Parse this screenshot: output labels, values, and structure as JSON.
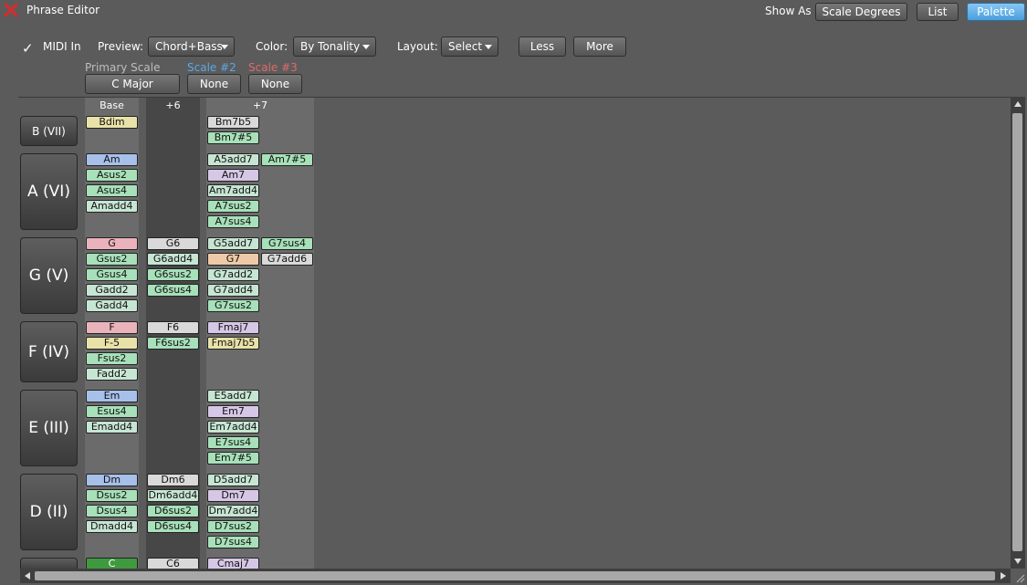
{
  "window": {
    "title": "Phrase Editor"
  },
  "show_as": {
    "label": "Show As",
    "buttons": [
      {
        "label": "Scale Degrees",
        "active": false
      },
      {
        "label": "List",
        "active": false
      },
      {
        "label": "Palette",
        "active": true
      }
    ]
  },
  "toolbar": {
    "midi_label": "MIDI In",
    "midi_checked": true,
    "check_glyph": "✓",
    "preview_label": "Preview:",
    "preview_value": "Chord+Bass",
    "color_label": "Color:",
    "color_value": "By Tonality",
    "layout_label": "Layout:",
    "layout_value": "Select",
    "less_label": "Less",
    "more_label": "More"
  },
  "scales": {
    "primary_label": "Primary Scale",
    "primary_value": "C Major",
    "scale2_label": "Scale #2",
    "scale2_value": "None",
    "scale3_label": "Scale #3",
    "scale3_value": "None"
  },
  "columns": [
    {
      "label": "Base"
    },
    {
      "label": "+6"
    },
    {
      "label": "+7"
    }
  ],
  "rows": [
    {
      "label": "B (VII)",
      "base": [
        {
          "name": "Bdim",
          "color": "#e8e2a8"
        }
      ],
      "six": [],
      "seven": [
        [
          {
            "name": "Bm7b5",
            "color": "#d9d9d9"
          }
        ],
        [
          {
            "name": "Bm7#5",
            "color": "#a7e0b9"
          }
        ]
      ]
    },
    {
      "label": "A (VI)",
      "base": [
        {
          "name": "Am",
          "color": "#a7c0ea"
        },
        {
          "name": "Asus2",
          "color": "#a7e0b9"
        },
        {
          "name": "Asus4",
          "color": "#a7e0b9"
        },
        {
          "name": "Amadd4",
          "color": "#c7e5d3"
        }
      ],
      "six": [],
      "seven": [
        [
          {
            "name": "A5add7",
            "color": "#c7e5d3"
          },
          {
            "name": "Am7#5",
            "color": "#a7e0b9"
          }
        ],
        [
          {
            "name": "Am7",
            "color": "#d6c7e6"
          }
        ],
        [
          {
            "name": "Am7add4",
            "color": "#c7e5d3"
          }
        ],
        [
          {
            "name": "A7sus2",
            "color": "#a7e0b9"
          }
        ],
        [
          {
            "name": "A7sus4",
            "color": "#a7e0b9"
          }
        ]
      ]
    },
    {
      "label": "G (V)",
      "base": [
        {
          "name": "G",
          "color": "#eab3bb"
        },
        {
          "name": "Gsus2",
          "color": "#a7e0b9"
        },
        {
          "name": "Gsus4",
          "color": "#a7e0b9"
        },
        {
          "name": "Gadd2",
          "color": "#c7e5d3"
        },
        {
          "name": "Gadd4",
          "color": "#c7e5d3"
        }
      ],
      "six": [
        {
          "name": "G6",
          "color": "#d9d9d9"
        },
        {
          "name": "G6add4",
          "color": "#c7e5d3"
        },
        {
          "name": "G6sus2",
          "color": "#a7e0b9"
        },
        {
          "name": "G6sus4",
          "color": "#a7e0b9"
        }
      ],
      "seven": [
        [
          {
            "name": "G5add7",
            "color": "#c7e5d3"
          },
          {
            "name": "G7sus4",
            "color": "#a7e0b9"
          }
        ],
        [
          {
            "name": "G7",
            "color": "#eec9a8"
          },
          {
            "name": "G7add6",
            "color": "#d9d9d9"
          }
        ],
        [
          {
            "name": "G7add2",
            "color": "#c7e5d3"
          }
        ],
        [
          {
            "name": "G7add4",
            "color": "#c7e5d3"
          }
        ],
        [
          {
            "name": "G7sus2",
            "color": "#a7e0b9"
          }
        ]
      ]
    },
    {
      "label": "F (IV)",
      "base": [
        {
          "name": "F",
          "color": "#eab3bb"
        },
        {
          "name": "F-5",
          "color": "#e8e2a8"
        },
        {
          "name": "Fsus2",
          "color": "#a7e0b9"
        },
        {
          "name": "Fadd2",
          "color": "#c7e5d3"
        }
      ],
      "six": [
        {
          "name": "F6",
          "color": "#d9d9d9"
        },
        {
          "name": "F6sus2",
          "color": "#a7e0b9"
        }
      ],
      "seven": [
        [
          {
            "name": "Fmaj7",
            "color": "#d6c7e6"
          }
        ],
        [
          {
            "name": "Fmaj7b5",
            "color": "#e8e2a8"
          }
        ]
      ]
    },
    {
      "label": "E (III)",
      "base": [
        {
          "name": "Em",
          "color": "#a7c0ea"
        },
        {
          "name": "Esus4",
          "color": "#a7e0b9"
        },
        {
          "name": "Emadd4",
          "color": "#c7e5d3"
        }
      ],
      "six": [],
      "seven": [
        [
          {
            "name": "E5add7",
            "color": "#c7e5d3"
          }
        ],
        [
          {
            "name": "Em7",
            "color": "#d6c7e6"
          }
        ],
        [
          {
            "name": "Em7add4",
            "color": "#c7e5d3"
          }
        ],
        [
          {
            "name": "E7sus4",
            "color": "#a7e0b9"
          }
        ],
        [
          {
            "name": "Em7#5",
            "color": "#a7e0b9"
          }
        ]
      ]
    },
    {
      "label": "D (II)",
      "base": [
        {
          "name": "Dm",
          "color": "#a7c0ea"
        },
        {
          "name": "Dsus2",
          "color": "#a7e0b9"
        },
        {
          "name": "Dsus4",
          "color": "#a7e0b9"
        },
        {
          "name": "Dmadd4",
          "color": "#c7e5d3"
        }
      ],
      "six": [
        {
          "name": "Dm6",
          "color": "#d9d9d9"
        },
        {
          "name": "Dm6add4",
          "color": "#c7e5d3"
        },
        {
          "name": "D6sus2",
          "color": "#a7e0b9"
        },
        {
          "name": "D6sus4",
          "color": "#a7e0b9"
        }
      ],
      "seven": [
        [
          {
            "name": "D5add7",
            "color": "#c7e5d3"
          }
        ],
        [
          {
            "name": "Dm7",
            "color": "#d6c7e6"
          }
        ],
        [
          {
            "name": "Dm7add4",
            "color": "#c7e5d3"
          }
        ],
        [
          {
            "name": "D7sus2",
            "color": "#a7e0b9"
          }
        ],
        [
          {
            "name": "D7sus4",
            "color": "#a7e0b9"
          }
        ]
      ]
    },
    {
      "label": "",
      "base": [
        {
          "name": "C",
          "color": "#3f9a3f"
        }
      ],
      "six": [
        {
          "name": "C6",
          "color": "#d9d9d9"
        }
      ],
      "seven": [
        [
          {
            "name": "Cmaj7",
            "color": "#d6c7e6"
          }
        ]
      ]
    }
  ],
  "colors": {
    "accent": "#5aa9e6",
    "scale2": "#5aa9e6",
    "scale3": "#e06a6a",
    "primary_scale_label": "#bdbdbd",
    "close": "#d22d2d"
  },
  "icons": {
    "close": "close-x-icon",
    "dropdown": "chevron-down-icon",
    "check": "check-icon"
  }
}
